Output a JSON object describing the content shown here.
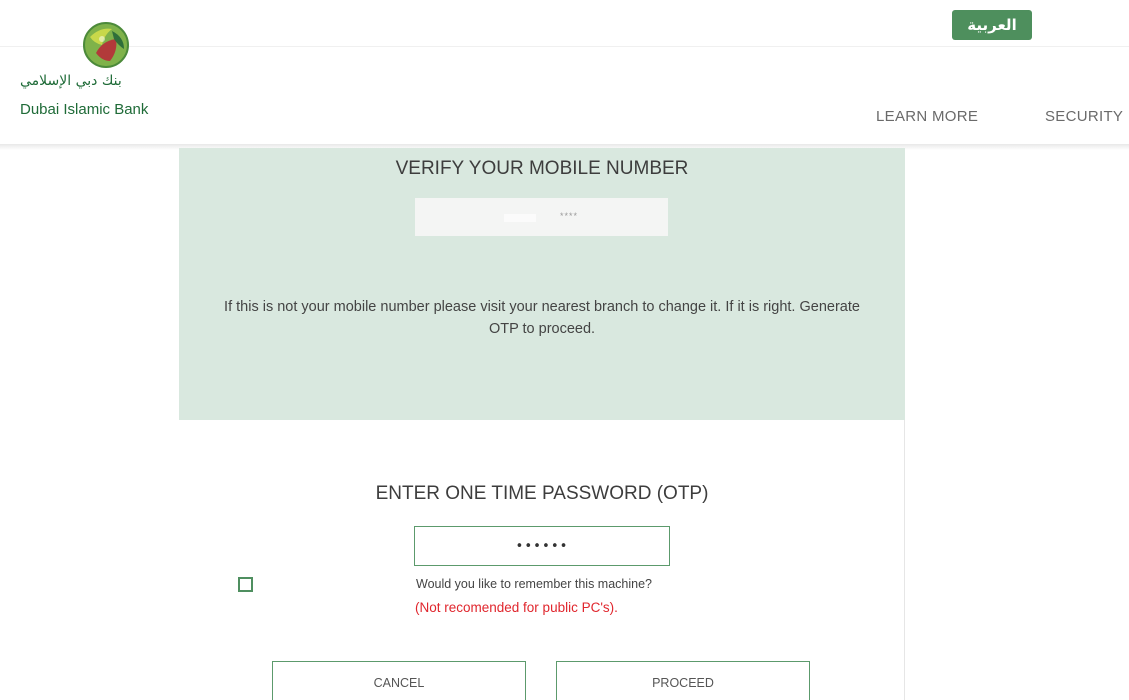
{
  "header": {
    "language_label": "العربية",
    "logo": {
      "arabic_name": "بنك دبي الإسلامي",
      "english_name": "Dubai Islamic Bank"
    },
    "nav": [
      {
        "label": "LEARN MORE"
      },
      {
        "label": "SECURITY"
      }
    ]
  },
  "verify": {
    "title": "VERIFY YOUR MOBILE NUMBER",
    "masked_number": "****",
    "message": "If this is not your mobile number please visit your nearest branch to change it. If it is right. Generate OTP to proceed."
  },
  "otp": {
    "title": "ENTER ONE TIME PASSWORD (OTP)",
    "value": "••••••",
    "remember_label": "Would you like to remember this machine?",
    "remember_warning": "(Not recomended for public PC's).",
    "remember_checked": false
  },
  "actions": {
    "cancel_label": "CANCEL",
    "proceed_label": "PROCEED"
  },
  "colors": {
    "brand_green": "#4e8f5d",
    "panel_bg": "#d9e8df",
    "warning_red": "#e0262d"
  }
}
